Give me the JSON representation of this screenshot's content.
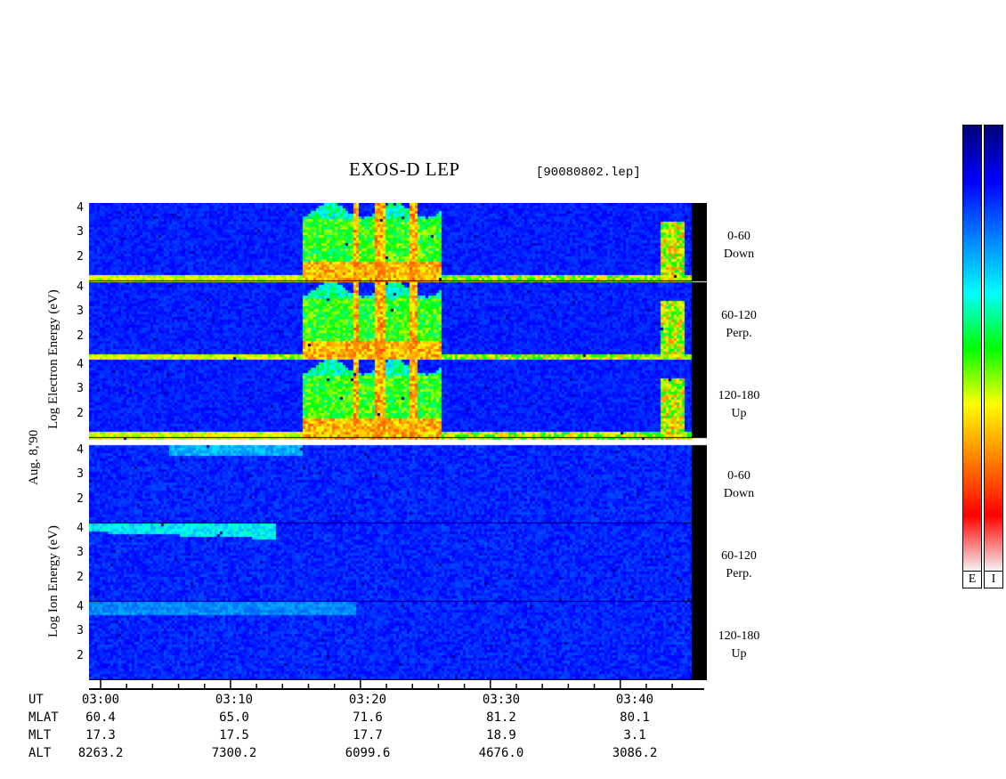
{
  "chart_data": {
    "type": "heatmap",
    "title": "EXOS-D LEP",
    "file_label": "[90080802.lep]",
    "date_label": "Aug. 8,'90",
    "groups": [
      {
        "name": "electron",
        "ylabel": "Log Electron Energy (eV)",
        "panels": [
          {
            "angle": "0-60",
            "direction": "Down"
          },
          {
            "angle": "60-120",
            "direction": "Perp."
          },
          {
            "angle": "120-180",
            "direction": "Up"
          }
        ]
      },
      {
        "name": "ion",
        "ylabel": "Log Ion Energy (eV)",
        "panels": [
          {
            "angle": "0-60",
            "direction": "Down"
          },
          {
            "angle": "60-120",
            "direction": "Perp."
          },
          {
            "angle": "120-180",
            "direction": "Up"
          }
        ]
      }
    ],
    "y_ticks": [
      "4",
      "3",
      "2"
    ],
    "ylim": [
      1,
      4.2
    ],
    "x_ticks": [
      "03:00",
      "03:10",
      "03:20",
      "03:30",
      "03:40"
    ],
    "xlim_minutes": [
      0,
      45.5
    ],
    "ephemeris": [
      {
        "label": "UT",
        "values": [
          "03:00",
          "03:10",
          "03:20",
          "03:30",
          "03:40"
        ]
      },
      {
        "label": "MLAT",
        "values": [
          "60.4",
          "65.0",
          "71.6",
          "81.2",
          "80.1"
        ]
      },
      {
        "label": "MLT",
        "values": [
          "17.3",
          "17.5",
          "17.7",
          "18.9",
          "3.1"
        ]
      },
      {
        "label": "ALT",
        "values": [
          "8263.2",
          "7300.2",
          "6099.6",
          "4676.0",
          "3086.2"
        ]
      }
    ],
    "colorbars": [
      {
        "label": "E"
      },
      {
        "label": "I"
      }
    ],
    "colorscale": [
      "#f4f4f4",
      "#ff0000",
      "#ff8000",
      "#ffff00",
      "#00ff00",
      "#00ffff",
      "#0080ff",
      "#0000ff",
      "#00007a"
    ]
  }
}
